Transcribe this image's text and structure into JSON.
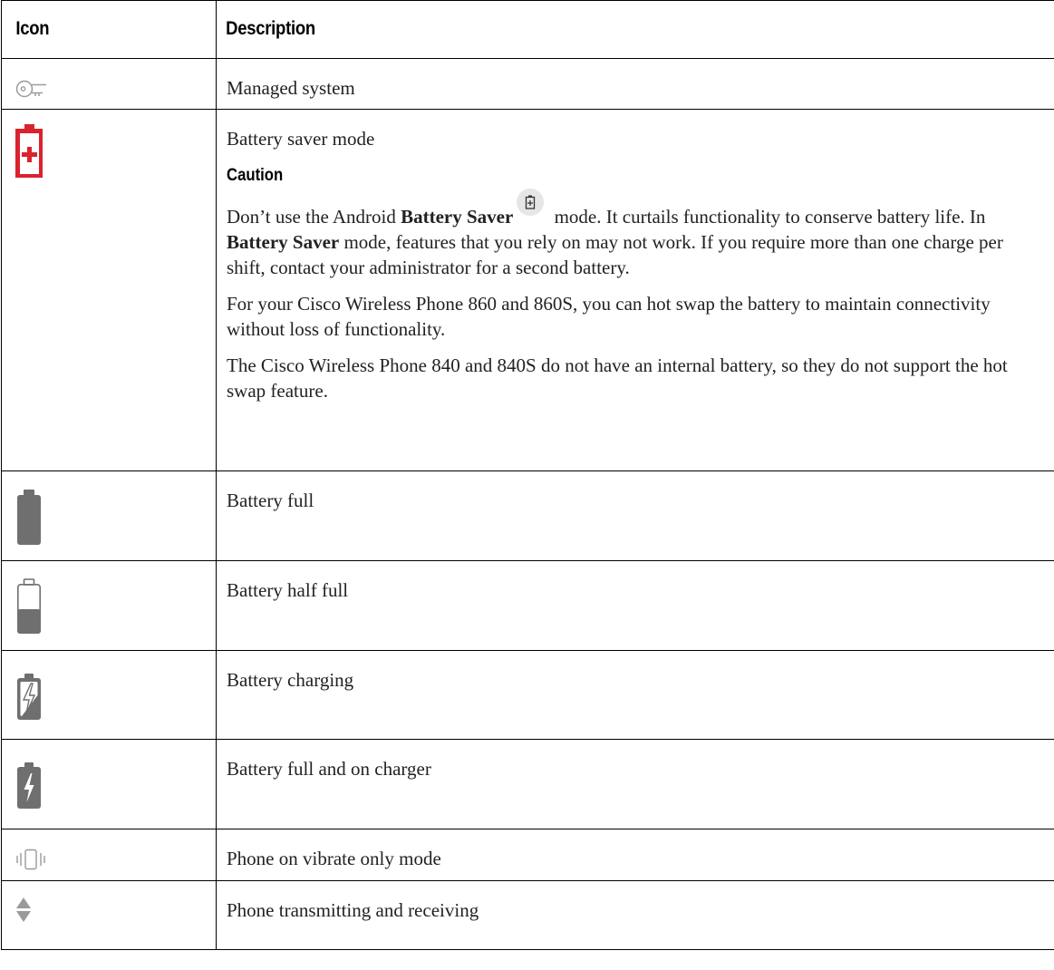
{
  "header": {
    "icon_col": "Icon",
    "desc_col": "Description"
  },
  "rows": [
    {
      "icon": "key-icon",
      "label": "Managed system"
    },
    {
      "icon": "battery-saver-icon",
      "label": "Battery saver mode",
      "caution_label": "Caution",
      "caution_p1_part1": "Don’t use the Android ",
      "caution_p1_bold1": "Battery Saver",
      "caution_p1_part2": " mode. It curtails functionality to conserve battery life. In ",
      "caution_p1_bold2": "Battery Saver",
      "caution_p1_part3": " mode, features that you rely on may not work. If you require more than one charge per shift, contact your administrator for a second battery.",
      "p2": "For your Cisco Wireless Phone 860 and 860S, you can hot swap the battery to maintain connectivity without loss of functionality.",
      "p3": "The Cisco Wireless Phone 840 and 840S do not have an internal battery, so they do not support the hot swap feature."
    },
    {
      "icon": "battery-full-icon",
      "label": "Battery full"
    },
    {
      "icon": "battery-half-icon",
      "label": "Battery half full",
      "level": 0.5
    },
    {
      "icon": "battery-charging-icon",
      "label": "Battery charging"
    },
    {
      "icon": "battery-full-charger-icon",
      "label": "Battery full and on charger"
    },
    {
      "icon": "vibrate-icon",
      "label": "Phone on vibrate only mode"
    },
    {
      "icon": "transmit-receive-icon",
      "label": "Phone transmitting and receiving"
    }
  ],
  "colors": {
    "icon_gray": "#6f6f6f",
    "saver_red": "#d9232e",
    "border": "#000000"
  }
}
